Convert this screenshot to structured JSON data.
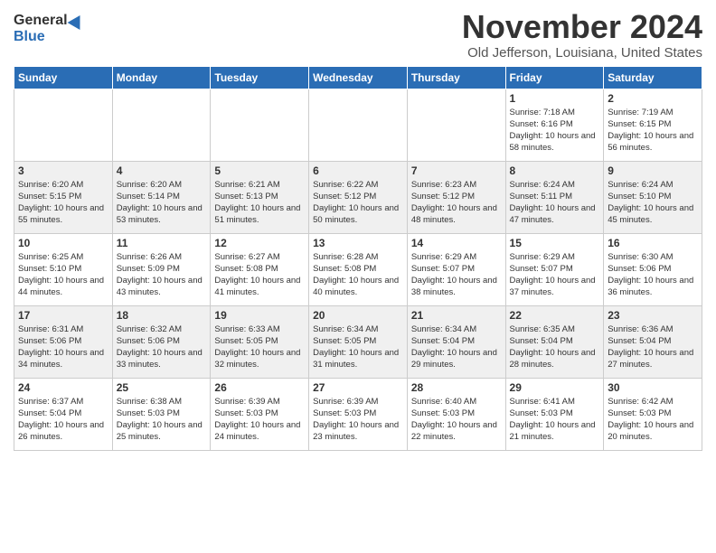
{
  "header": {
    "logo_general": "General",
    "logo_blue": "Blue",
    "month": "November 2024",
    "location": "Old Jefferson, Louisiana, United States"
  },
  "weekdays": [
    "Sunday",
    "Monday",
    "Tuesday",
    "Wednesday",
    "Thursday",
    "Friday",
    "Saturday"
  ],
  "weeks": [
    [
      {
        "day": "",
        "info": ""
      },
      {
        "day": "",
        "info": ""
      },
      {
        "day": "",
        "info": ""
      },
      {
        "day": "",
        "info": ""
      },
      {
        "day": "",
        "info": ""
      },
      {
        "day": "1",
        "info": "Sunrise: 7:18 AM\nSunset: 6:16 PM\nDaylight: 10 hours and 58 minutes."
      },
      {
        "day": "2",
        "info": "Sunrise: 7:19 AM\nSunset: 6:15 PM\nDaylight: 10 hours and 56 minutes."
      }
    ],
    [
      {
        "day": "3",
        "info": "Sunrise: 6:20 AM\nSunset: 5:15 PM\nDaylight: 10 hours and 55 minutes."
      },
      {
        "day": "4",
        "info": "Sunrise: 6:20 AM\nSunset: 5:14 PM\nDaylight: 10 hours and 53 minutes."
      },
      {
        "day": "5",
        "info": "Sunrise: 6:21 AM\nSunset: 5:13 PM\nDaylight: 10 hours and 51 minutes."
      },
      {
        "day": "6",
        "info": "Sunrise: 6:22 AM\nSunset: 5:12 PM\nDaylight: 10 hours and 50 minutes."
      },
      {
        "day": "7",
        "info": "Sunrise: 6:23 AM\nSunset: 5:12 PM\nDaylight: 10 hours and 48 minutes."
      },
      {
        "day": "8",
        "info": "Sunrise: 6:24 AM\nSunset: 5:11 PM\nDaylight: 10 hours and 47 minutes."
      },
      {
        "day": "9",
        "info": "Sunrise: 6:24 AM\nSunset: 5:10 PM\nDaylight: 10 hours and 45 minutes."
      }
    ],
    [
      {
        "day": "10",
        "info": "Sunrise: 6:25 AM\nSunset: 5:10 PM\nDaylight: 10 hours and 44 minutes."
      },
      {
        "day": "11",
        "info": "Sunrise: 6:26 AM\nSunset: 5:09 PM\nDaylight: 10 hours and 43 minutes."
      },
      {
        "day": "12",
        "info": "Sunrise: 6:27 AM\nSunset: 5:08 PM\nDaylight: 10 hours and 41 minutes."
      },
      {
        "day": "13",
        "info": "Sunrise: 6:28 AM\nSunset: 5:08 PM\nDaylight: 10 hours and 40 minutes."
      },
      {
        "day": "14",
        "info": "Sunrise: 6:29 AM\nSunset: 5:07 PM\nDaylight: 10 hours and 38 minutes."
      },
      {
        "day": "15",
        "info": "Sunrise: 6:29 AM\nSunset: 5:07 PM\nDaylight: 10 hours and 37 minutes."
      },
      {
        "day": "16",
        "info": "Sunrise: 6:30 AM\nSunset: 5:06 PM\nDaylight: 10 hours and 36 minutes."
      }
    ],
    [
      {
        "day": "17",
        "info": "Sunrise: 6:31 AM\nSunset: 5:06 PM\nDaylight: 10 hours and 34 minutes."
      },
      {
        "day": "18",
        "info": "Sunrise: 6:32 AM\nSunset: 5:06 PM\nDaylight: 10 hours and 33 minutes."
      },
      {
        "day": "19",
        "info": "Sunrise: 6:33 AM\nSunset: 5:05 PM\nDaylight: 10 hours and 32 minutes."
      },
      {
        "day": "20",
        "info": "Sunrise: 6:34 AM\nSunset: 5:05 PM\nDaylight: 10 hours and 31 minutes."
      },
      {
        "day": "21",
        "info": "Sunrise: 6:34 AM\nSunset: 5:04 PM\nDaylight: 10 hours and 29 minutes."
      },
      {
        "day": "22",
        "info": "Sunrise: 6:35 AM\nSunset: 5:04 PM\nDaylight: 10 hours and 28 minutes."
      },
      {
        "day": "23",
        "info": "Sunrise: 6:36 AM\nSunset: 5:04 PM\nDaylight: 10 hours and 27 minutes."
      }
    ],
    [
      {
        "day": "24",
        "info": "Sunrise: 6:37 AM\nSunset: 5:04 PM\nDaylight: 10 hours and 26 minutes."
      },
      {
        "day": "25",
        "info": "Sunrise: 6:38 AM\nSunset: 5:03 PM\nDaylight: 10 hours and 25 minutes."
      },
      {
        "day": "26",
        "info": "Sunrise: 6:39 AM\nSunset: 5:03 PM\nDaylight: 10 hours and 24 minutes."
      },
      {
        "day": "27",
        "info": "Sunrise: 6:39 AM\nSunset: 5:03 PM\nDaylight: 10 hours and 23 minutes."
      },
      {
        "day": "28",
        "info": "Sunrise: 6:40 AM\nSunset: 5:03 PM\nDaylight: 10 hours and 22 minutes."
      },
      {
        "day": "29",
        "info": "Sunrise: 6:41 AM\nSunset: 5:03 PM\nDaylight: 10 hours and 21 minutes."
      },
      {
        "day": "30",
        "info": "Sunrise: 6:42 AM\nSunset: 5:03 PM\nDaylight: 10 hours and 20 minutes."
      }
    ]
  ]
}
